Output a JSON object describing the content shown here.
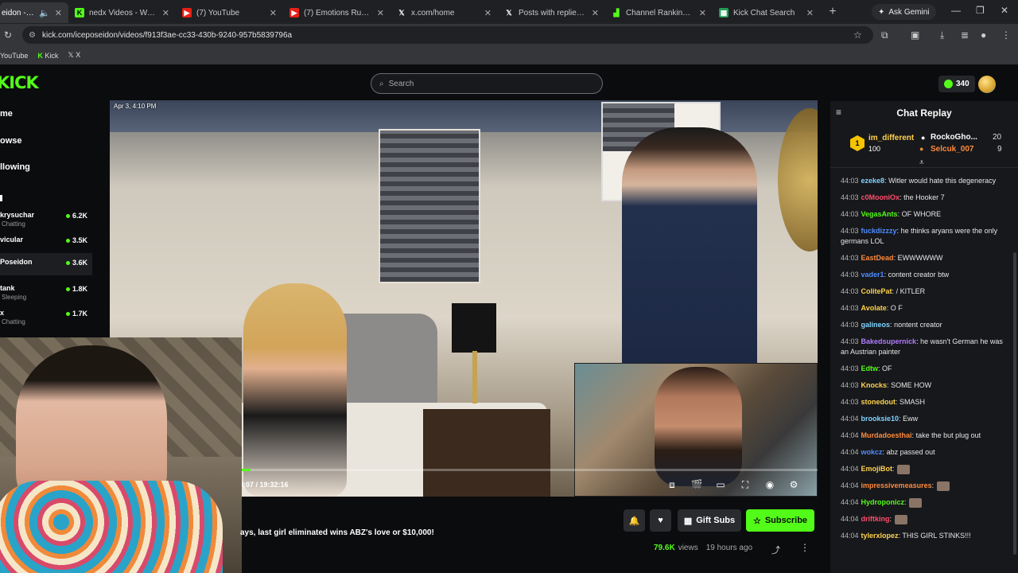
{
  "browser": {
    "tabs": [
      {
        "title": "eidon - Wat",
        "favicon": "kick-icon",
        "active": true
      },
      {
        "title": "nedx Videos - Watch C",
        "favicon": "kick-icon"
      },
      {
        "title": "(7) YouTube",
        "favicon": "youtube-icon"
      },
      {
        "title": "(7) Emotions Run High",
        "favicon": "youtube-icon"
      },
      {
        "title": "x.com/home",
        "favicon": "x-icon"
      },
      {
        "title": "Posts with replies by Tr",
        "favicon": "x-icon"
      },
      {
        "title": "Channel Rankings - Kic",
        "favicon": "chart-icon"
      },
      {
        "title": "Kick Chat Search",
        "favicon": "sheet-icon"
      }
    ],
    "gemini_label": "Ask Gemini",
    "url": "kick.com/iceposeidon/videos/f913f3ae-cc33-430b-9240-957b5839796a",
    "bookmarks": [
      "YouTube",
      "Kick",
      "X"
    ]
  },
  "header": {
    "logo": "KICK",
    "search_placeholder": "Search",
    "points": "340"
  },
  "sidebar": {
    "nav": [
      "me",
      "owse",
      "llowing"
    ],
    "channels": [
      {
        "name": "krysuchar",
        "status": "Chatting",
        "viewers": "6.2K"
      },
      {
        "name": "vicular",
        "status": "",
        "viewers": "3.5K"
      },
      {
        "name": "Poseidon",
        "status": "",
        "viewers": "3.6K",
        "selected": true
      },
      {
        "name": "tank",
        "status": "Sleeping",
        "viewers": "1.8K"
      },
      {
        "name": "x",
        "status": "Chatting",
        "viewers": "1.7K"
      }
    ]
  },
  "video": {
    "date": "Apr 3, 4:10 PM",
    "timecode": "44:07 / 19:32:16",
    "timecode_visible": "4:07 / 19:32:16",
    "progress_fraction": 0.038,
    "title": "ays, last girl eliminated wins ABZ's love or $10,000!",
    "views": "79.6K",
    "views_label": "views",
    "age": "19 hours ago",
    "gift_label": "Gift Subs",
    "subscribe_label": "Subscribe"
  },
  "chat": {
    "title": "Chat Replay",
    "leaderboard": [
      {
        "rank": "1",
        "name": "im_different",
        "count": "100"
      },
      {
        "name": "RockoGho...",
        "count": "20"
      },
      {
        "name": "Selcuk_007",
        "count": "9"
      }
    ],
    "messages": [
      {
        "ts": "44:03",
        "user": "ezeke8",
        "color": "#7fd3ff",
        "text": "Witler would hate this degeneracy"
      },
      {
        "ts": "44:03",
        "user": "c0MooniOx",
        "color": "#ff4d6d",
        "text": "the Hooker 7"
      },
      {
        "ts": "44:03",
        "user": "VegasAnts",
        "color": "#53fc18",
        "text": "OF WHORE"
      },
      {
        "ts": "44:03",
        "user": "fuckdizzzy",
        "color": "#4f8cff",
        "text": "he thinks aryans were the only germans LOL"
      },
      {
        "ts": "44:03",
        "user": "EastDead",
        "color": "#ff8a3d",
        "text": "EWWWWWW"
      },
      {
        "ts": "44:03",
        "user": "vader1",
        "color": "#4f8cff",
        "text": "content creator btw"
      },
      {
        "ts": "44:03",
        "user": "ColitePat",
        "color": "#ffd24d",
        "text": "/ KITLER"
      },
      {
        "ts": "44:03",
        "user": "Avolate",
        "color": "#ffd24d",
        "text": "O F"
      },
      {
        "ts": "44:03",
        "user": "galineos",
        "color": "#7fd3ff",
        "text": "nontent creator"
      },
      {
        "ts": "44:03",
        "user": "Bakedsupernick",
        "color": "#b07cff",
        "text": "he wasn't German he was an Austrian painter"
      },
      {
        "ts": "44:03",
        "user": "Edtw",
        "color": "#53fc18",
        "text": "OF"
      },
      {
        "ts": "44:03",
        "user": "Knocks",
        "color": "#ffd24d",
        "text": "SOME HOW"
      },
      {
        "ts": "44:03",
        "user": "stonedout",
        "color": "#ffd24d",
        "text": "SMASH"
      },
      {
        "ts": "44:04",
        "user": "brooksie10",
        "color": "#7fd3ff",
        "text": "Eww"
      },
      {
        "ts": "44:04",
        "user": "Murdadoesthai",
        "color": "#ff8a3d",
        "text": "take the but plug out"
      },
      {
        "ts": "44:04",
        "user": "wokcz",
        "color": "#4f8cff",
        "text": "abz passed out"
      },
      {
        "ts": "44:04",
        "user": "EmojiBot",
        "color": "#ffd24d",
        "text": ""
      },
      {
        "ts": "44:04",
        "user": "impressivemeasures",
        "color": "#ff8a3d",
        "text": ""
      },
      {
        "ts": "44:04",
        "user": "Hydroponicz",
        "color": "#53fc18",
        "text": ""
      },
      {
        "ts": "44:04",
        "user": "driftking",
        "color": "#ff4d6d",
        "text": ""
      },
      {
        "ts": "44:04",
        "user": "tylerxlopez",
        "color": "#ffd24d",
        "text": "THIS GIRL STINKS!!!"
      }
    ]
  },
  "colors": {
    "accent": "#53fc18",
    "bg": "#0b0c0e",
    "chat_bg": "#17181b"
  }
}
